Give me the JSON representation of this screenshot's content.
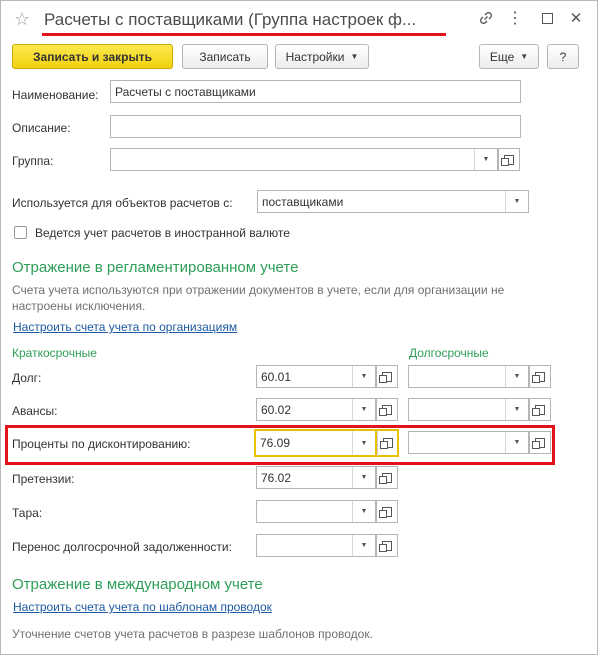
{
  "window": {
    "title": "Расчеты с поставщиками (Группа настроек ф..."
  },
  "toolbar": {
    "save_close_label": "Записать и закрыть",
    "save_label": "Записать",
    "settings_label": "Настройки",
    "more_label": "Еще",
    "help_label": "?"
  },
  "form": {
    "name_label": "Наименование:",
    "name_value": "Расчеты с поставщиками",
    "description_label": "Описание:",
    "description_value": "",
    "group_label": "Группа:",
    "group_value": "",
    "used_for_label": "Используется для объектов расчетов с:",
    "used_for_value": "поставщиками",
    "currency_checkbox_label": "Ведется учет расчетов в иностранной валюте",
    "currency_checked": false
  },
  "reg_section": {
    "title": "Отражение в регламентированном учете",
    "note": "Счета учета используются при отражении документов в учете, если для организации не настроены исключения.",
    "link": "Настроить счета учета по организациям",
    "short_term_label": "Краткосрочные",
    "long_term_label": "Долгосрочные",
    "rows": [
      {
        "label": "Долг:",
        "short": "60.01",
        "long": ""
      },
      {
        "label": "Авансы:",
        "short": "60.02",
        "long": ""
      },
      {
        "label": "Проценты по дисконтированию:",
        "short": "76.09",
        "long": ""
      },
      {
        "label": "Претензии:",
        "short": "76.02",
        "long": null
      },
      {
        "label": "Тара:",
        "short": "",
        "long": null
      },
      {
        "label": "Перенос долгосрочной задолженности:",
        "short": "",
        "long": null
      }
    ]
  },
  "intl_section": {
    "title": "Отражение в международном учете",
    "link": "Настроить счета учета по шаблонам проводок",
    "note": "Уточнение счетов учета расчетов в разрезе шаблонов проводок."
  },
  "colors": {
    "accent_green": "#2e9e57",
    "link_blue": "#1c5aa3",
    "primary_yellow": "#f2d20e",
    "highlight_red": "#e2141b",
    "focus_yellow": "#e8c200"
  }
}
